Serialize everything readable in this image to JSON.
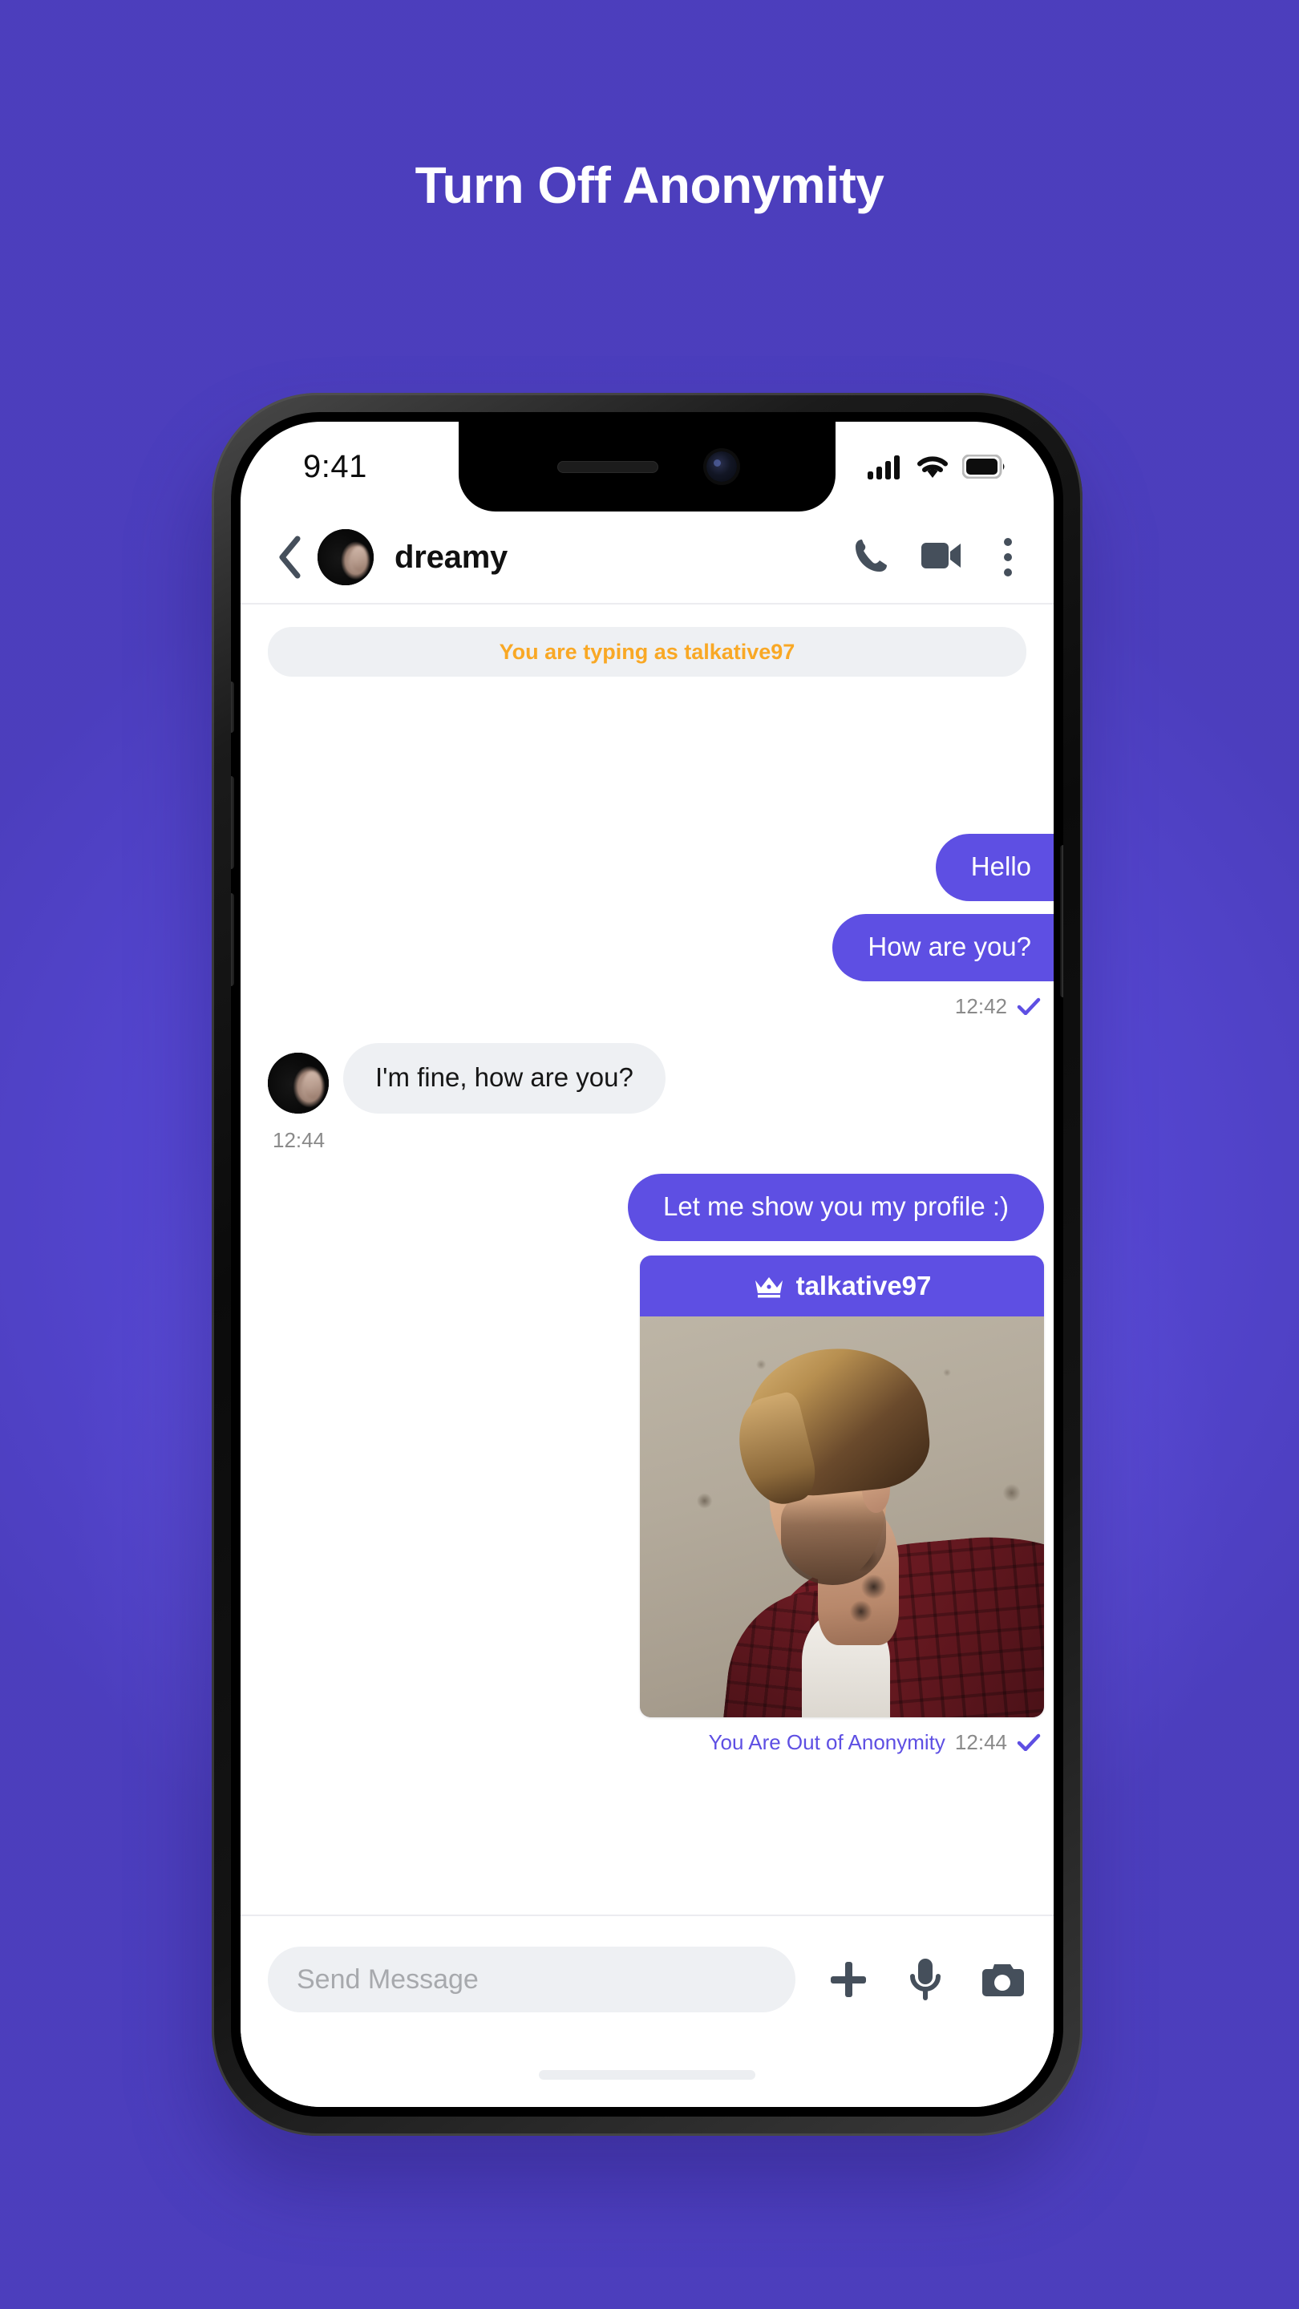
{
  "headline": "Turn Off Anonymity",
  "theme": {
    "background_purple": "#5E4FE3",
    "accent_purple": "#5E4FE3",
    "warning_orange": "#F9A825",
    "bubble_in_gray": "#EEF0F3",
    "meta_gray": "#8A8A8A"
  },
  "status_bar": {
    "time": "9:41",
    "icons": [
      "cellular-signal-icon",
      "wifi-icon",
      "battery-icon"
    ]
  },
  "chat_header": {
    "back_icon": "chevron-left-icon",
    "avatar": "contact-avatar",
    "contact_name": "dreamy",
    "actions": [
      "phone-call-icon",
      "video-camera-icon",
      "more-options-icon"
    ]
  },
  "banner": {
    "text": "You are typing as talkative97"
  },
  "messages": [
    {
      "id": "m1",
      "direction": "out",
      "text": "Hello",
      "shape": "clipped-right"
    },
    {
      "id": "m2",
      "direction": "out",
      "text": "How are you?",
      "shape": "clipped-right",
      "time": "12:42",
      "status_icon": "double-check-icon"
    },
    {
      "id": "m3",
      "direction": "in",
      "text": "I'm fine, how are you?",
      "time": "12:44"
    },
    {
      "id": "m4",
      "direction": "out",
      "text": "Let me show you my profile :)",
      "shape": "rounded"
    }
  ],
  "profile_card": {
    "crown_icon": "crown-icon",
    "username": "talkative97",
    "photo_alt": "profile-photo",
    "footer_label": "You Are Out of Anonymity",
    "footer_time": "12:44",
    "footer_status_icon": "check-icon"
  },
  "input_bar": {
    "placeholder": "Send Message",
    "value": "",
    "buttons": [
      "plus-icon",
      "microphone-icon",
      "camera-icon"
    ]
  }
}
